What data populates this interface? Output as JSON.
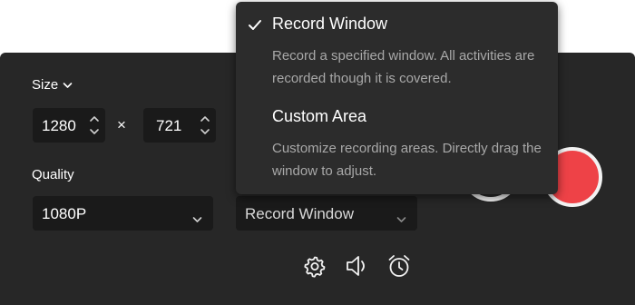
{
  "size": {
    "label": "Size",
    "width_value": "1280",
    "separator": "×",
    "height_value": "721"
  },
  "quality": {
    "label": "Quality",
    "selected": "1080P"
  },
  "mode": {
    "selected": "Record Window"
  },
  "mode_menu": {
    "items": [
      {
        "title": "Record Window",
        "checked": true,
        "description": "Record a specified window. All activities are recorded though it is covered."
      },
      {
        "title": "Custom Area",
        "checked": false,
        "description": "Customize recording areas. Directly drag the window to adjust."
      }
    ]
  },
  "toolbar": {
    "icons": [
      "settings-icon",
      "volume-icon",
      "alarm-icon"
    ]
  },
  "colors": {
    "panel_bg": "#272727",
    "field_bg": "#1a1a1a",
    "menu_bg": "#2c2c2c",
    "record_red": "#ee4247",
    "text": "#ffffff",
    "muted_text": "#a8a8a8"
  }
}
